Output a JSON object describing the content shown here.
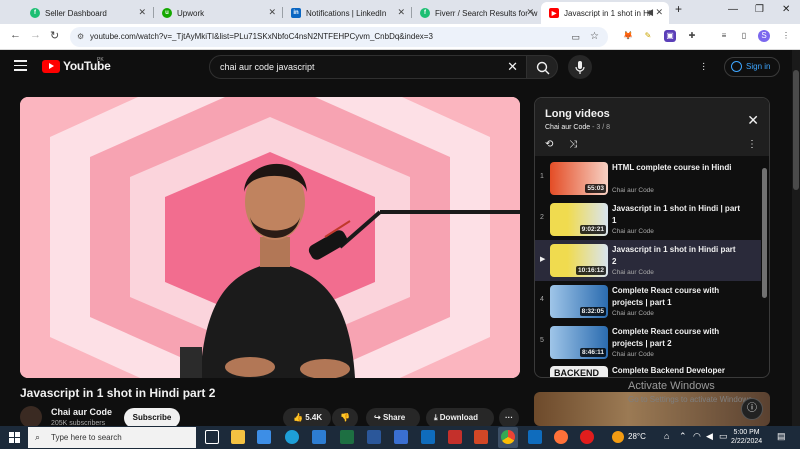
{
  "browser": {
    "tabs": [
      {
        "title": "Seller Dashboard",
        "favicon": "fiverr-icon",
        "color": "#1dbf73",
        "glyph": "f"
      },
      {
        "title": "Upwork",
        "favicon": "upwork-icon",
        "color": "#14a800",
        "glyph": "up"
      },
      {
        "title": "Notifications | LinkedIn",
        "favicon": "linkedin-icon",
        "color": "#0a66c2",
        "glyph": "in"
      },
      {
        "title": "Fiverr / Search Results for 'w",
        "favicon": "fiverr-icon",
        "color": "#1dbf73",
        "glyph": "f"
      },
      {
        "title": "Javascript in 1 shot in Hi",
        "favicon": "youtube-icon",
        "color": "#ff0000",
        "glyph": "▶"
      }
    ],
    "new_tab": "+",
    "url": "youtube.com/watch?v=_TjtAyMkiTI&list=PLu71SKxNbfoC4nsN2NTFEHPCyvm_CnbDq&index=3",
    "profile_letter": "S"
  },
  "youtube": {
    "logo_text": "YouTube",
    "country": "PK",
    "search_query": "chai aur code javascript",
    "sign_in": "Sign in"
  },
  "video": {
    "title": "Javascript in 1 shot in Hindi part 2",
    "channel": "Chai aur Code",
    "subscribers": "205K subscribers",
    "subscribe_label": "Subscribe",
    "likes": "5.4K",
    "share_label": "Share",
    "download_label": "Download"
  },
  "playlist": {
    "title": "Long videos",
    "channel": "Chai aur Code",
    "position": "3 / 8",
    "items": [
      {
        "index": "1",
        "title": "HTML complete course in Hindi",
        "channel": "Chai aur Code",
        "duration": "55:03",
        "thumb_color": "#e44d26"
      },
      {
        "index": "2",
        "title": "Javascript in 1 shot in Hindi | part 1",
        "channel": "Chai aur Code",
        "duration": "9:02:21",
        "thumb_color": "#f0db4f"
      },
      {
        "index": "▶",
        "title": "Javascript in 1 shot in Hindi part 2",
        "channel": "Chai aur Code",
        "duration": "10:16:12",
        "thumb_color": "#f0db4f"
      },
      {
        "index": "4",
        "title": "Complete React course with projects | part 1",
        "channel": "Chai aur Code",
        "duration": "8:32:05",
        "thumb_color": "#2b6cb0"
      },
      {
        "index": "5",
        "title": "Complete React course with projects | part 2",
        "channel": "Chai aur Code",
        "duration": "8:46:11",
        "thumb_color": "#2b6cb0"
      },
      {
        "index": "",
        "title": "Complete Backend Developer",
        "channel": "",
        "duration": "BACKEND",
        "thumb_color": "#111"
      }
    ]
  },
  "watermark": {
    "line1": "Activate Windows",
    "line2": "Go to Settings to activate Windows."
  },
  "taskbar": {
    "search_placeholder": "Type here to search",
    "temperature": "28°C",
    "time": "5:00 PM",
    "date": "2/22/2024"
  }
}
